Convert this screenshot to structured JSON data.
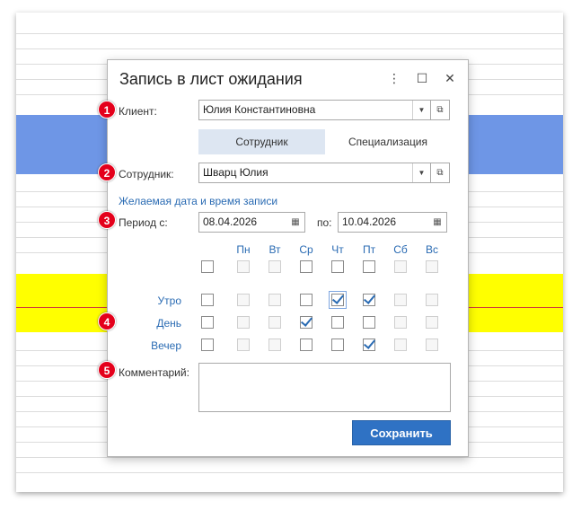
{
  "dialog": {
    "title": "Запись в лист ожидания",
    "menu_icon": "⋮",
    "maximize_icon": "☐",
    "close_icon": "✕"
  },
  "badges": [
    "1",
    "2",
    "3",
    "4",
    "5"
  ],
  "client": {
    "label": "Клиент:",
    "value": "Юлия Константиновна"
  },
  "tabs": [
    {
      "label": "Сотрудник",
      "active": true
    },
    {
      "label": "Специализация",
      "active": false
    }
  ],
  "employee": {
    "label": "Сотрудник:",
    "value": "Шварц Юлия"
  },
  "desired_link": "Желаемая дата и время записи",
  "period": {
    "from_label": "Период с:",
    "from_value": "08.04.2026",
    "to_label": "по:",
    "to_value": "10.04.2026"
  },
  "days": [
    "Пн",
    "Вт",
    "Ср",
    "Чт",
    "Пт",
    "Сб",
    "Вс"
  ],
  "time_rows": [
    {
      "label": "Утро",
      "checked": [
        false,
        false,
        false,
        true,
        true,
        false,
        false
      ]
    },
    {
      "label": "День",
      "checked": [
        false,
        false,
        true,
        false,
        false,
        false,
        false
      ]
    },
    {
      "label": "Вечер",
      "checked": [
        false,
        false,
        false,
        false,
        true,
        false,
        false
      ]
    }
  ],
  "comment": {
    "label": "Комментарий:",
    "value": ""
  },
  "save_button": "Сохранить",
  "colors": {
    "accent": "#2f72c4",
    "link": "#2a6bb3",
    "badge": "#e4001b",
    "band_blue": "#6e96e6",
    "band_yellow": "#ffff00"
  }
}
